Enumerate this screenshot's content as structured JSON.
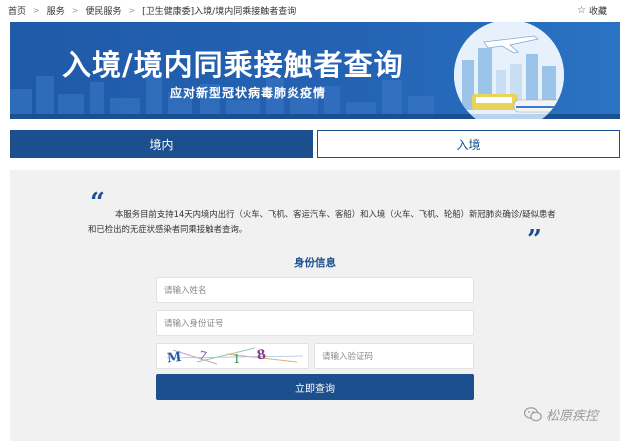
{
  "breadcrumb": {
    "items": [
      "首页",
      "服务",
      "便民服务",
      "[卫生健康委]入境/境内同乘接触者查询"
    ],
    "separator": ">"
  },
  "favorite": {
    "label": "收藏",
    "icon": "star-icon"
  },
  "banner": {
    "title": "入境/境内同乘接触者查询",
    "subtitle": "应对新型冠状病毒肺炎疫情"
  },
  "tabs": [
    {
      "label": "境内",
      "active": true
    },
    {
      "label": "入境",
      "active": false
    }
  ],
  "notice": {
    "open_quote": "“",
    "close_quote": "”",
    "text": "本服务目前支持14天内境内出行（火车、飞机、客运汽车、客船）和入境（火车、飞机、轮船）新冠肺炎确诊/疑似患者和已检出的无症状感染者同乘接触者查询。"
  },
  "form": {
    "section_title": "身份信息",
    "name_placeholder": "请输入姓名",
    "id_placeholder": "请输入身份证号",
    "captcha_text": "M 7 1 8",
    "code_placeholder": "请输入验证码",
    "submit_label": "立即查询"
  },
  "watermark": {
    "text": "松原疾控",
    "icon": "wechat-icon"
  },
  "colors": {
    "primary": "#1b4f8e",
    "banner": "#2462b3",
    "panel": "#f1f1f1"
  }
}
